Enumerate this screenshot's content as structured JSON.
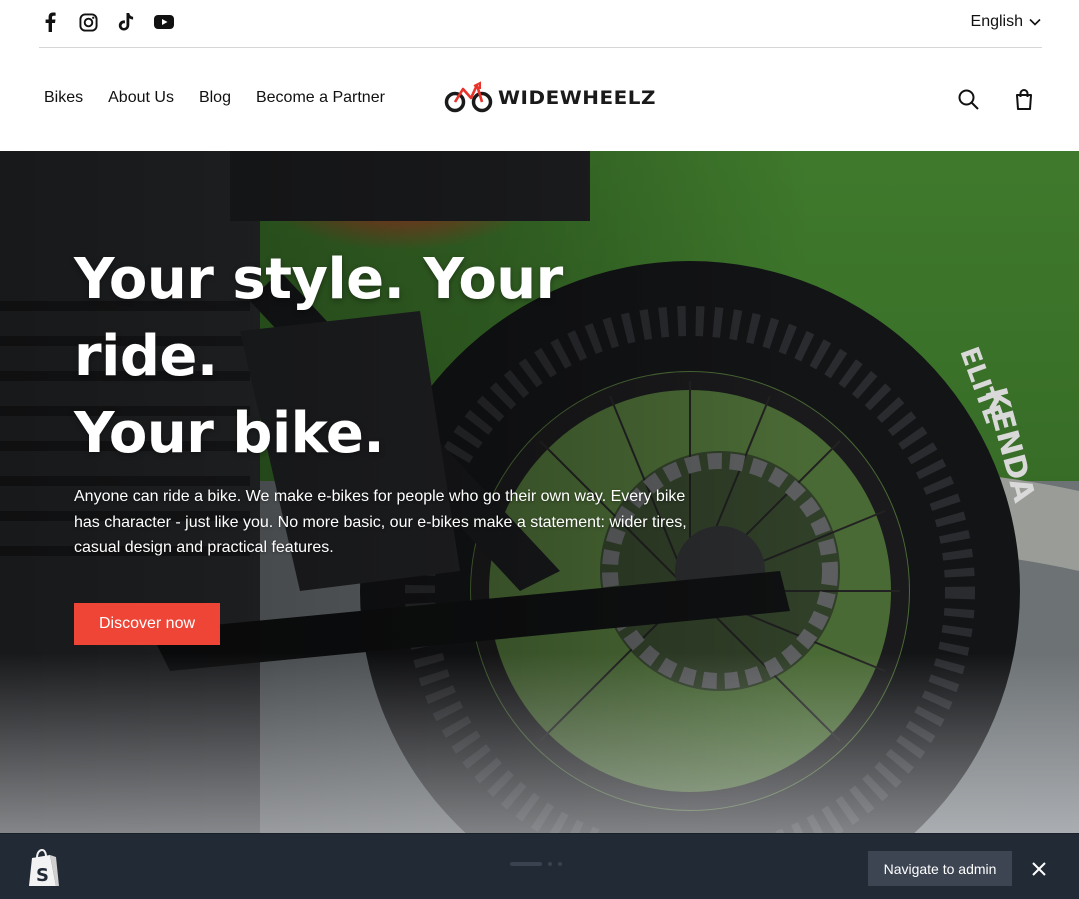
{
  "topbar": {
    "social_icons": [
      "facebook-icon",
      "instagram-icon",
      "tiktok-icon",
      "youtube-icon"
    ],
    "language": "English"
  },
  "header": {
    "nav": [
      "Bikes",
      "About Us",
      "Blog",
      "Become a Partner"
    ],
    "logo_text": "WIDEWHEELZ",
    "actions": [
      "search-icon",
      "cart-icon"
    ]
  },
  "hero": {
    "title_line1": "Your style. Your ride.",
    "title_line2": "Your bike.",
    "text": "Anyone can ride a bike. We make e-bikes for people who go their own way. Every bike has character - just like you. No more basic, our e-bikes make a statement: wider tires, casual design and practical features.",
    "button": "Discover now"
  },
  "adminbar": {
    "navigate_label": "Navigate to admin"
  },
  "colors": {
    "accent": "#ee4536",
    "admin_bg": "#222a36",
    "admin_button": "#3d4553"
  }
}
